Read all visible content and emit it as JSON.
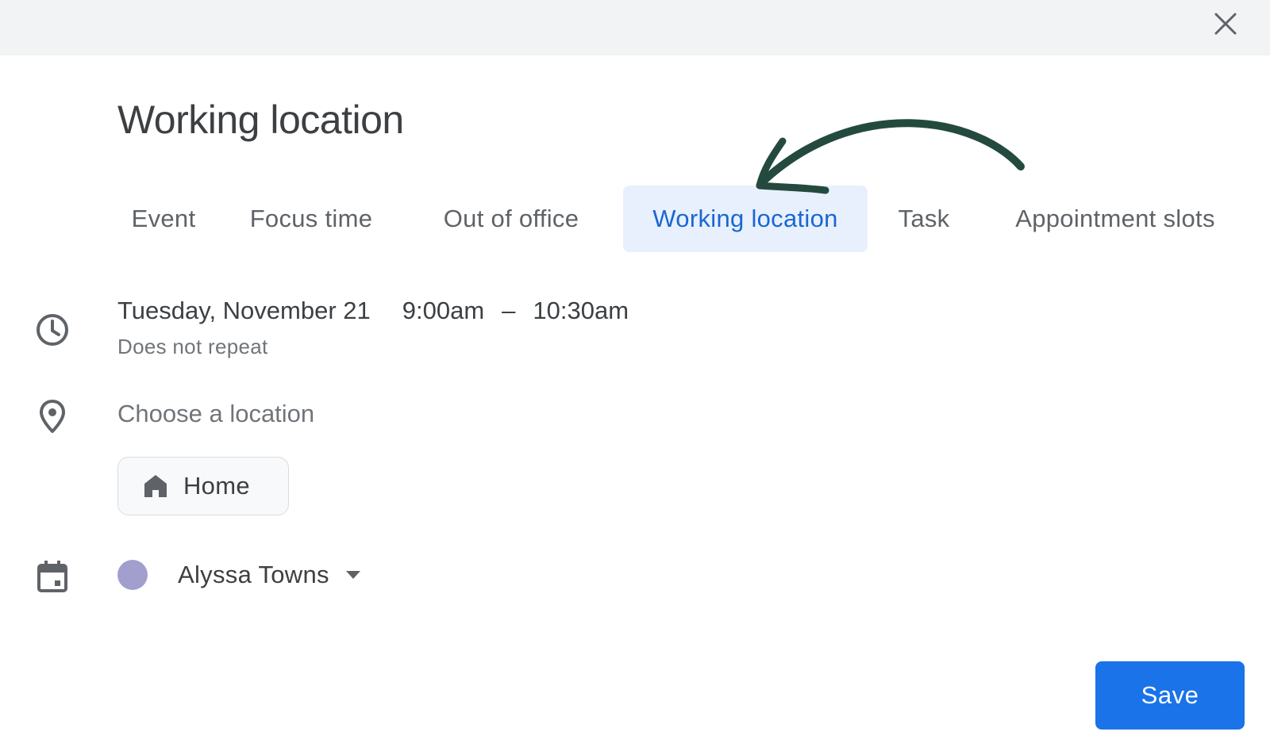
{
  "dialog": {
    "title": "Working location",
    "close_icon": "close-icon"
  },
  "tabs": [
    {
      "label": "Event",
      "active": false
    },
    {
      "label": "Focus time",
      "active": false
    },
    {
      "label": "Out of office",
      "active": false
    },
    {
      "label": "Working location",
      "active": true
    },
    {
      "label": "Task",
      "active": false
    },
    {
      "label": "Appointment slots",
      "active": false
    }
  ],
  "time": {
    "icon": "clock-icon",
    "date": "Tuesday, November 21",
    "start": "9:00am",
    "separator": "–",
    "end": "10:30am",
    "repeat": "Does not repeat"
  },
  "location": {
    "icon": "location-pin-icon",
    "placeholder": "Choose a location",
    "value": "",
    "chip_icon": "home-icon",
    "chip_label": "Home"
  },
  "calendar": {
    "icon": "calendar-icon",
    "owner": "Alyssa Towns",
    "dropdown_icon": "caret-down-icon",
    "color": "#a29fcf"
  },
  "actions": {
    "save_label": "Save",
    "save_color": "#1a73e8"
  },
  "colors": {
    "accent": "#1967d2",
    "active_tab_bg": "#e8f0fe",
    "annotation_arrow": "#244a3f"
  }
}
